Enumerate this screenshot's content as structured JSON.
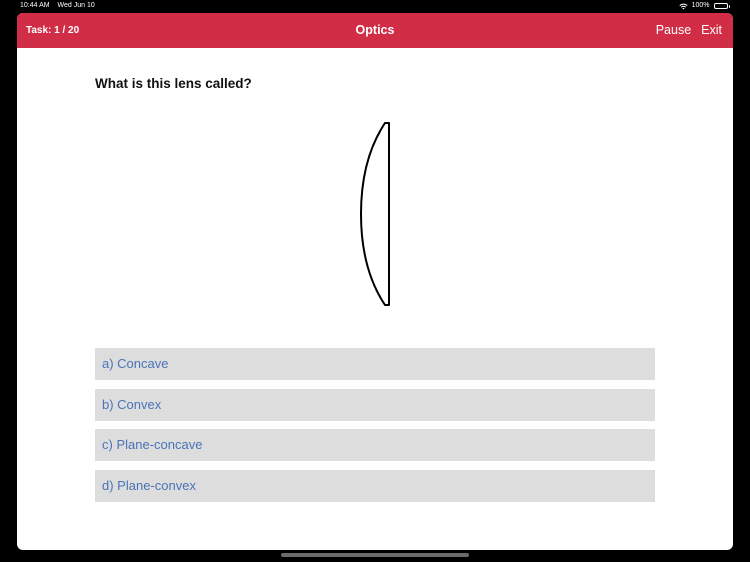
{
  "status_bar": {
    "time": "10:44 AM",
    "date": "Wed Jun 10",
    "battery_percent": "100%",
    "battery_level": 1.0,
    "wifi_icon": "wifi-icon",
    "battery_icon": "battery-icon"
  },
  "nav": {
    "task_counter": "Task: 1 / 20",
    "title": "Optics",
    "pause_label": "Pause",
    "exit_label": "Exit",
    "background_color": "#d22d47"
  },
  "question": {
    "text": "What is this lens called?",
    "figure_icon": "plano-convex-lens-icon"
  },
  "answers": [
    {
      "label": "a) Concave"
    },
    {
      "label": "b) Convex"
    },
    {
      "label": "c) Plane-concave"
    },
    {
      "label": "d) Plane-convex"
    }
  ],
  "colors": {
    "accent": "#d22d47",
    "answer_text": "#4a73b8",
    "answer_background": "#dddddd"
  }
}
